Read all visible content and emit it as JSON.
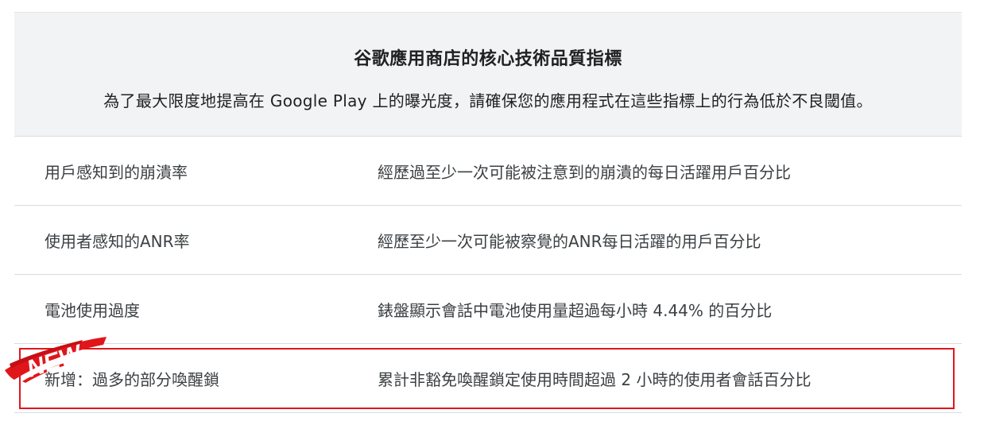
{
  "header": {
    "title": "谷歌應用商店的核心技術品質指標",
    "subtitle": "為了最大限度地提高在 Google Play 上的曝光度，請確保您的應用程式在這些指標上的行為低於不良閾值。"
  },
  "rows": [
    {
      "metric": "用戶感知到的崩潰率",
      "description": "經歷過至少一次可能被注意到的崩潰的每日活躍用戶百分比"
    },
    {
      "metric": "使用者感知的ANR率",
      "description": "經歷至少一次可能被察覺的ANR每日活躍的用戶百分比"
    },
    {
      "metric": "電池使用過度",
      "description": "錶盤顯示會話中電池使用量超過每小時 4.44% 的百分比"
    },
    {
      "metric": "新增：過多的部分喚醒鎖",
      "description": "累計非豁免喚醒鎖定使用時間超過 2 小時的使用者會話百分比"
    }
  ],
  "badge": {
    "label": "NEW",
    "color": "#e0161b"
  },
  "colors": {
    "header_bg": "#f1f3f4",
    "highlight_border": "#e0161b",
    "divider": "#dadce0"
  }
}
